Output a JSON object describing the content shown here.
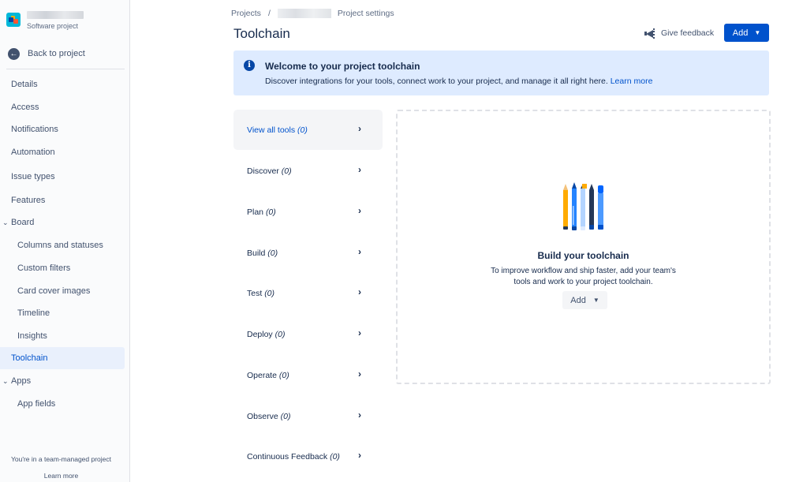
{
  "sidebar": {
    "project_type": "Software project",
    "back_label": "Back to project",
    "items": [
      {
        "label": "Details"
      },
      {
        "label": "Access"
      },
      {
        "label": "Notifications"
      },
      {
        "label": "Automation"
      },
      {
        "label": "Issue types"
      },
      {
        "label": "Features"
      },
      {
        "label": "Board"
      },
      {
        "label": "Columns and statuses"
      },
      {
        "label": "Custom filters"
      },
      {
        "label": "Card cover images"
      },
      {
        "label": "Timeline"
      },
      {
        "label": "Insights"
      },
      {
        "label": "Toolchain"
      },
      {
        "label": "Apps"
      },
      {
        "label": "App fields"
      }
    ],
    "footer_text": "You're in a team-managed project",
    "footer_link": "Learn more"
  },
  "breadcrumb": {
    "projects": "Projects",
    "separator": "/",
    "settings": "Project settings"
  },
  "header": {
    "title": "Toolchain",
    "feedback_label": "Give feedback",
    "add_label": "Add"
  },
  "banner": {
    "title": "Welcome to your project toolchain",
    "text": "Discover integrations for your tools, connect work to your project, and manage it all right here.",
    "link": "Learn more"
  },
  "categories": [
    {
      "label": "View all tools",
      "count": "(0)"
    },
    {
      "label": "Discover",
      "count": "(0)"
    },
    {
      "label": "Plan",
      "count": "(0)"
    },
    {
      "label": "Build",
      "count": "(0)"
    },
    {
      "label": "Test",
      "count": "(0)"
    },
    {
      "label": "Deploy",
      "count": "(0)"
    },
    {
      "label": "Operate",
      "count": "(0)"
    },
    {
      "label": "Observe",
      "count": "(0)"
    },
    {
      "label": "Continuous Feedback",
      "count": "(0)"
    }
  ],
  "empty_state": {
    "title": "Build your toolchain",
    "line1": "To improve workflow and ship faster, add your team's",
    "line2": "tools and work to your project toolchain.",
    "add_label": "Add"
  },
  "colors": {
    "primary": "#0052cc",
    "banner_bg": "#deebff",
    "active_nav_bg": "#e9f0fc",
    "text": "#172b4d"
  }
}
